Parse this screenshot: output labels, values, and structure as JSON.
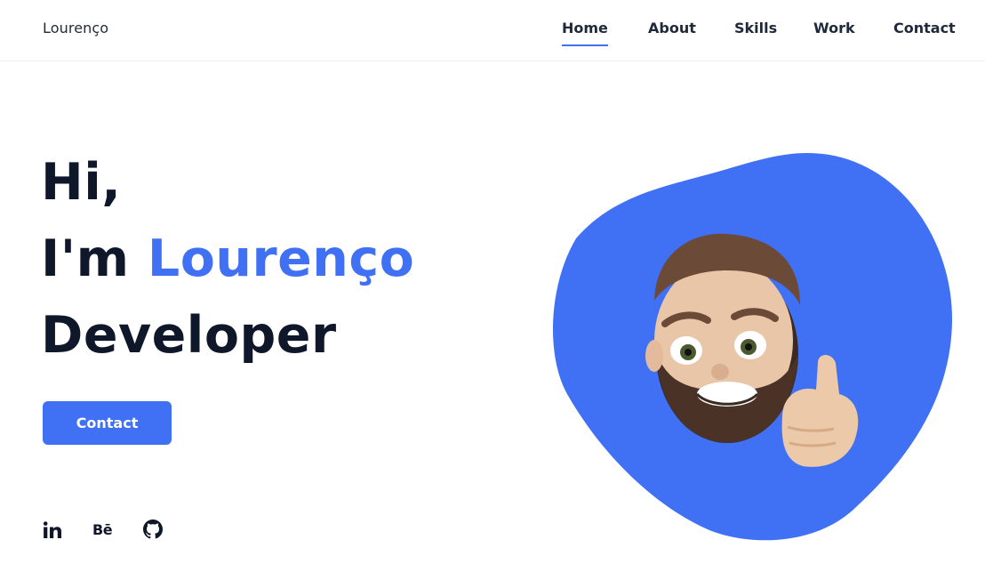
{
  "header": {
    "logo": "Lourenço",
    "nav": [
      {
        "label": "Home",
        "active": true
      },
      {
        "label": "About",
        "active": false
      },
      {
        "label": "Skills",
        "active": false
      },
      {
        "label": "Work",
        "active": false
      },
      {
        "label": "Contact",
        "active": false
      }
    ]
  },
  "hero": {
    "line1": "Hi,",
    "line2_prefix": "I'm",
    "line2_name": "Lourenço",
    "line3": "Developer",
    "cta_label": "Contact",
    "image_alt": "avatar-memoji-thumbs-up"
  },
  "social": [
    {
      "icon": "linkedin-icon",
      "text": "in"
    },
    {
      "icon": "behance-icon",
      "text": "Bē"
    },
    {
      "icon": "github-icon"
    }
  ],
  "colors": {
    "accent": "#4070f4",
    "text_dark": "#0f172a",
    "border": "#eef0f3"
  }
}
